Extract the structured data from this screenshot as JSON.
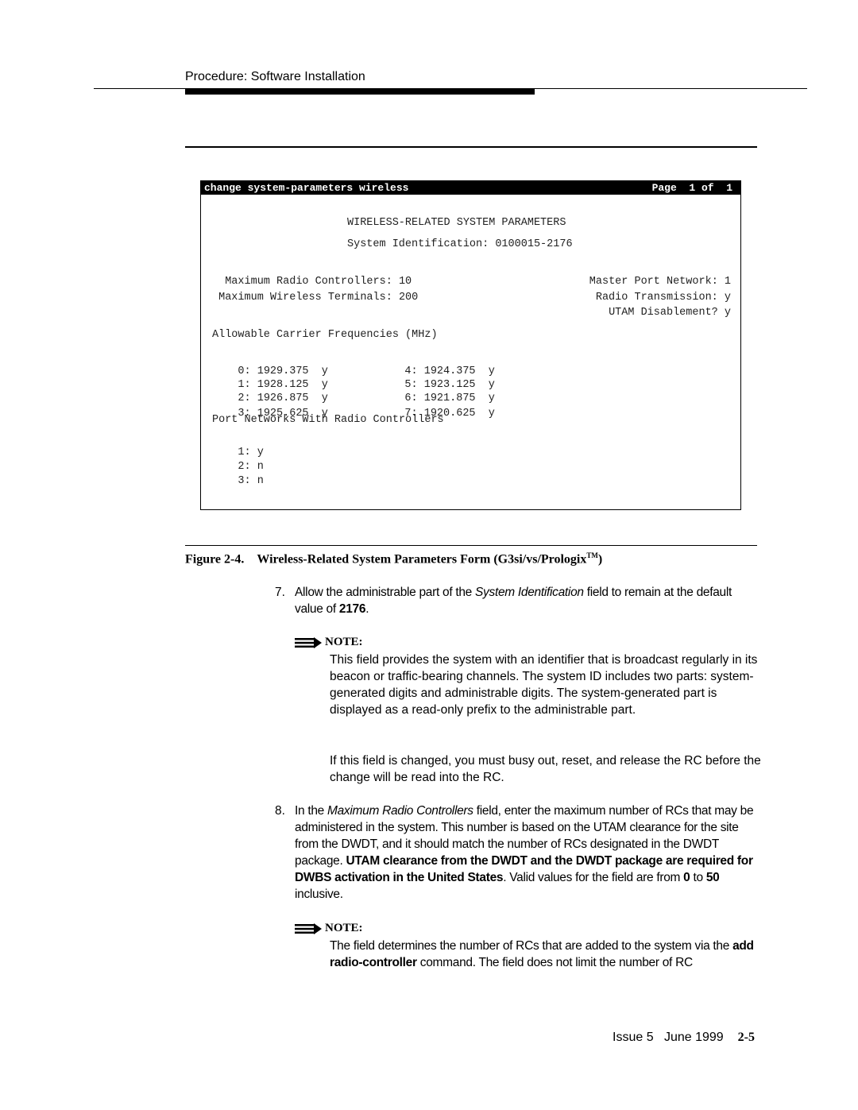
{
  "header": {
    "section_title": "Procedure: Software Installation"
  },
  "screen": {
    "command": "change system-parameters wireless",
    "page_label": "Page  1 of  1",
    "title": "WIRELESS-RELATED SYSTEM PARAMETERS",
    "system_identification": "System Identification: 0100015-2176",
    "left_fields": [
      "  Maximum Radio Controllers: 10",
      " Maximum Wireless Terminals: 200"
    ],
    "right_fields": [
      "Master Port Network: 1",
      "Radio Transmission: y",
      "UTAM Disablement? y"
    ],
    "frequencies_heading": "Allowable Carrier Frequencies (MHz)",
    "frequencies": [
      {
        "index": "0:",
        "freq": "1929.375",
        "flag": "y"
      },
      {
        "index": "1:",
        "freq": "1928.125",
        "flag": "y"
      },
      {
        "index": "2:",
        "freq": "1926.875",
        "flag": "y"
      },
      {
        "index": "3:",
        "freq": "1925.625",
        "flag": "y"
      },
      {
        "index": "4:",
        "freq": "1924.375",
        "flag": "y"
      },
      {
        "index": "5:",
        "freq": "1923.125",
        "flag": "y"
      },
      {
        "index": "6:",
        "freq": "1921.875",
        "flag": "y"
      },
      {
        "index": "7:",
        "freq": "1920.625",
        "flag": "y"
      }
    ],
    "port_networks_heading": "Port Networks With Radio Controllers",
    "port_networks": [
      {
        "index": "1:",
        "value": "y"
      },
      {
        "index": "2:",
        "value": "n"
      },
      {
        "index": "3:",
        "value": "n"
      }
    ]
  },
  "figure": {
    "label": "Figure 2-4.",
    "caption": "Wireless-Related System Parameters Form (G3si/vs/Prologix",
    "trademark": "TM",
    "caption_end": ")"
  },
  "steps": {
    "step7": {
      "num": "7.",
      "t1": "Allow the administrable part of the ",
      "t2_italic": "System Identification",
      "t3": " field to remain at the default value of ",
      "t4_bold": "2176",
      "t5": "."
    },
    "note1": {
      "heading": "NOTE:",
      "p1": "This field provides the system with an identifier that is broadcast regularly in its beacon or traffic-bearing channels. The system ID includes two parts: system-generated digits and administrable digits. The system-generated part is displayed as a read-only prefix to the administrable part.",
      "p2": "If this field is changed, you must busy out, reset, and release the RC before the change will be read into the RC."
    },
    "step8": {
      "num": "8.",
      "t1": "In the ",
      "t2_italic": "Maximum Radio Controllers",
      "t3": " field, enter the maximum number of RCs that may be administered in the system. This number is based on the UTAM clearance for the site from the DWDT, and it should match the number of RCs designated in the DWDT package. ",
      "t4_bold": "UTAM clearance from the DWDT and the DWDT package are required for DWBS activation in the United States",
      "t5": ". Valid values for the field are from ",
      "t6_bold": "0",
      "t7": " to ",
      "t8_bold": "50",
      "t9": " inclusive."
    },
    "note2": {
      "heading": "NOTE:",
      "t1": "The field determines the number of RCs that are added to the system via the ",
      "t2_bold": "add radio-controller",
      "t3": " command. The field does not limit the number of RC"
    }
  },
  "footer": {
    "issue": "Issue 5   June 1999",
    "page": "2-5"
  }
}
